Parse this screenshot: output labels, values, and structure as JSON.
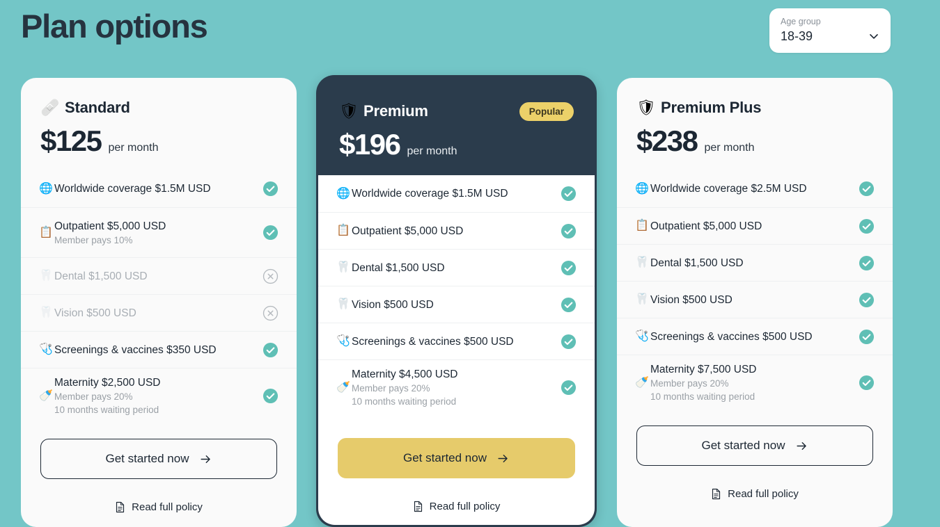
{
  "header": {
    "title": "Plan options",
    "age_group": {
      "label": "Age group",
      "value": "18-39",
      "chevron": "chevron-down-icon"
    }
  },
  "colors": {
    "background_teal": "#73c6c7",
    "dark_navy": "#2b3c4c",
    "accent_yellow": "#e6cb6b",
    "check_teal": "#5fbfb5",
    "text_dark": "#1c2733",
    "text_muted": "#9aa0a6"
  },
  "common": {
    "per_month": "per month",
    "cta_label": "Get started now",
    "policy_label": "Read full policy",
    "arrow_icon": "arrow-right-icon",
    "doc_icon": "document-icon",
    "check_icon": "check-circle-icon",
    "excluded_icon": "x-circle-icon"
  },
  "plans": [
    {
      "id": "standard",
      "name": "Standard",
      "emoji": "🩹",
      "emoji_name": "bandage-icon",
      "price": "$125",
      "badge": null,
      "highlighted": false,
      "features": [
        {
          "emoji": "🌐",
          "emoji_name": "globe-icon",
          "title": "Worldwide coverage $1.5M USD",
          "subs": [],
          "included": true
        },
        {
          "emoji": "📋",
          "emoji_name": "clipboard-plus-icon",
          "title": "Outpatient $5,000 USD",
          "subs": [
            "Member pays 10%"
          ],
          "included": true
        },
        {
          "emoji": "🦷",
          "emoji_name": "tooth-icon",
          "title": "Dental $1,500 USD",
          "subs": [],
          "included": false
        },
        {
          "emoji": "🦷",
          "emoji_name": "tooth-icon",
          "title": "Vision $500 USD",
          "subs": [],
          "included": false
        },
        {
          "emoji": "🩺",
          "emoji_name": "stethoscope-heart-icon",
          "title": "Screenings & vaccines $350 USD",
          "subs": [],
          "included": true
        },
        {
          "emoji": "🍼",
          "emoji_name": "pacifier-icon",
          "title": "Maternity $2,500 USD",
          "subs": [
            "Member pays 20%",
            "10 months waiting period"
          ],
          "included": true
        }
      ]
    },
    {
      "id": "premium",
      "name": "Premium",
      "emoji": "🛡",
      "emoji_name": "shield-heart-icon",
      "price": "$196",
      "badge": "Popular",
      "highlighted": true,
      "features": [
        {
          "emoji": "🌐",
          "emoji_name": "globe-icon",
          "title": "Worldwide coverage $1.5M USD",
          "subs": [],
          "included": true
        },
        {
          "emoji": "📋",
          "emoji_name": "clipboard-plus-icon",
          "title": "Outpatient $5,000 USD",
          "subs": [],
          "included": true
        },
        {
          "emoji": "🦷",
          "emoji_name": "tooth-icon",
          "title": "Dental $1,500 USD",
          "subs": [],
          "included": true
        },
        {
          "emoji": "🦷",
          "emoji_name": "tooth-icon",
          "title": "Vision $500 USD",
          "subs": [],
          "included": true
        },
        {
          "emoji": "🩺",
          "emoji_name": "stethoscope-heart-icon",
          "title": "Screenings & vaccines $500 USD",
          "subs": [],
          "included": true
        },
        {
          "emoji": "🍼",
          "emoji_name": "pacifier-icon",
          "title": "Maternity $4,500 USD",
          "subs": [
            "Member pays 20%",
            "10 months waiting period"
          ],
          "included": true
        }
      ]
    },
    {
      "id": "premium-plus",
      "name": "Premium Plus",
      "emoji": "🛡",
      "emoji_name": "shield-sparkle-icon",
      "price": "$238",
      "badge": null,
      "highlighted": false,
      "features": [
        {
          "emoji": "🌐",
          "emoji_name": "globe-icon",
          "title": "Worldwide coverage $2.5M USD",
          "subs": [],
          "included": true
        },
        {
          "emoji": "📋",
          "emoji_name": "clipboard-plus-icon",
          "title": "Outpatient $5,000 USD",
          "subs": [],
          "included": true
        },
        {
          "emoji": "🦷",
          "emoji_name": "tooth-icon",
          "title": "Dental $1,500 USD",
          "subs": [],
          "included": true
        },
        {
          "emoji": "🦷",
          "emoji_name": "tooth-icon",
          "title": "Vision $500 USD",
          "subs": [],
          "included": true
        },
        {
          "emoji": "🩺",
          "emoji_name": "stethoscope-heart-icon",
          "title": "Screenings & vaccines $500 USD",
          "subs": [],
          "included": true
        },
        {
          "emoji": "🍼",
          "emoji_name": "pacifier-icon",
          "title": "Maternity $7,500 USD",
          "subs": [
            "Member pays 20%",
            "10 months waiting period"
          ],
          "included": true
        }
      ]
    }
  ]
}
